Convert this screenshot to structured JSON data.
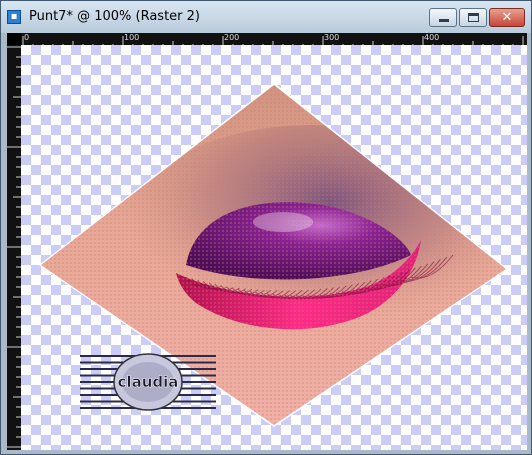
{
  "window": {
    "title": "Punt7* @ 100% (Raster 2)",
    "icon": "psp-document-icon",
    "controls": {
      "minimize": "minimize-icon",
      "maximize": "maximize-icon",
      "close": "close-icon",
      "close_glyph": "✕"
    }
  },
  "ruler": {
    "top_labels": [
      "0",
      "100",
      "200",
      "300",
      "400"
    ]
  },
  "canvas": {
    "checker_colors": [
      "#ffffff",
      "#cccdf6"
    ],
    "watermark_text": "claudia"
  },
  "colors": {
    "titlebar": "#c8d7e6",
    "skin": "#e8a89a",
    "eyelid": "#7a1c8a",
    "lashes": "#e0207a"
  }
}
